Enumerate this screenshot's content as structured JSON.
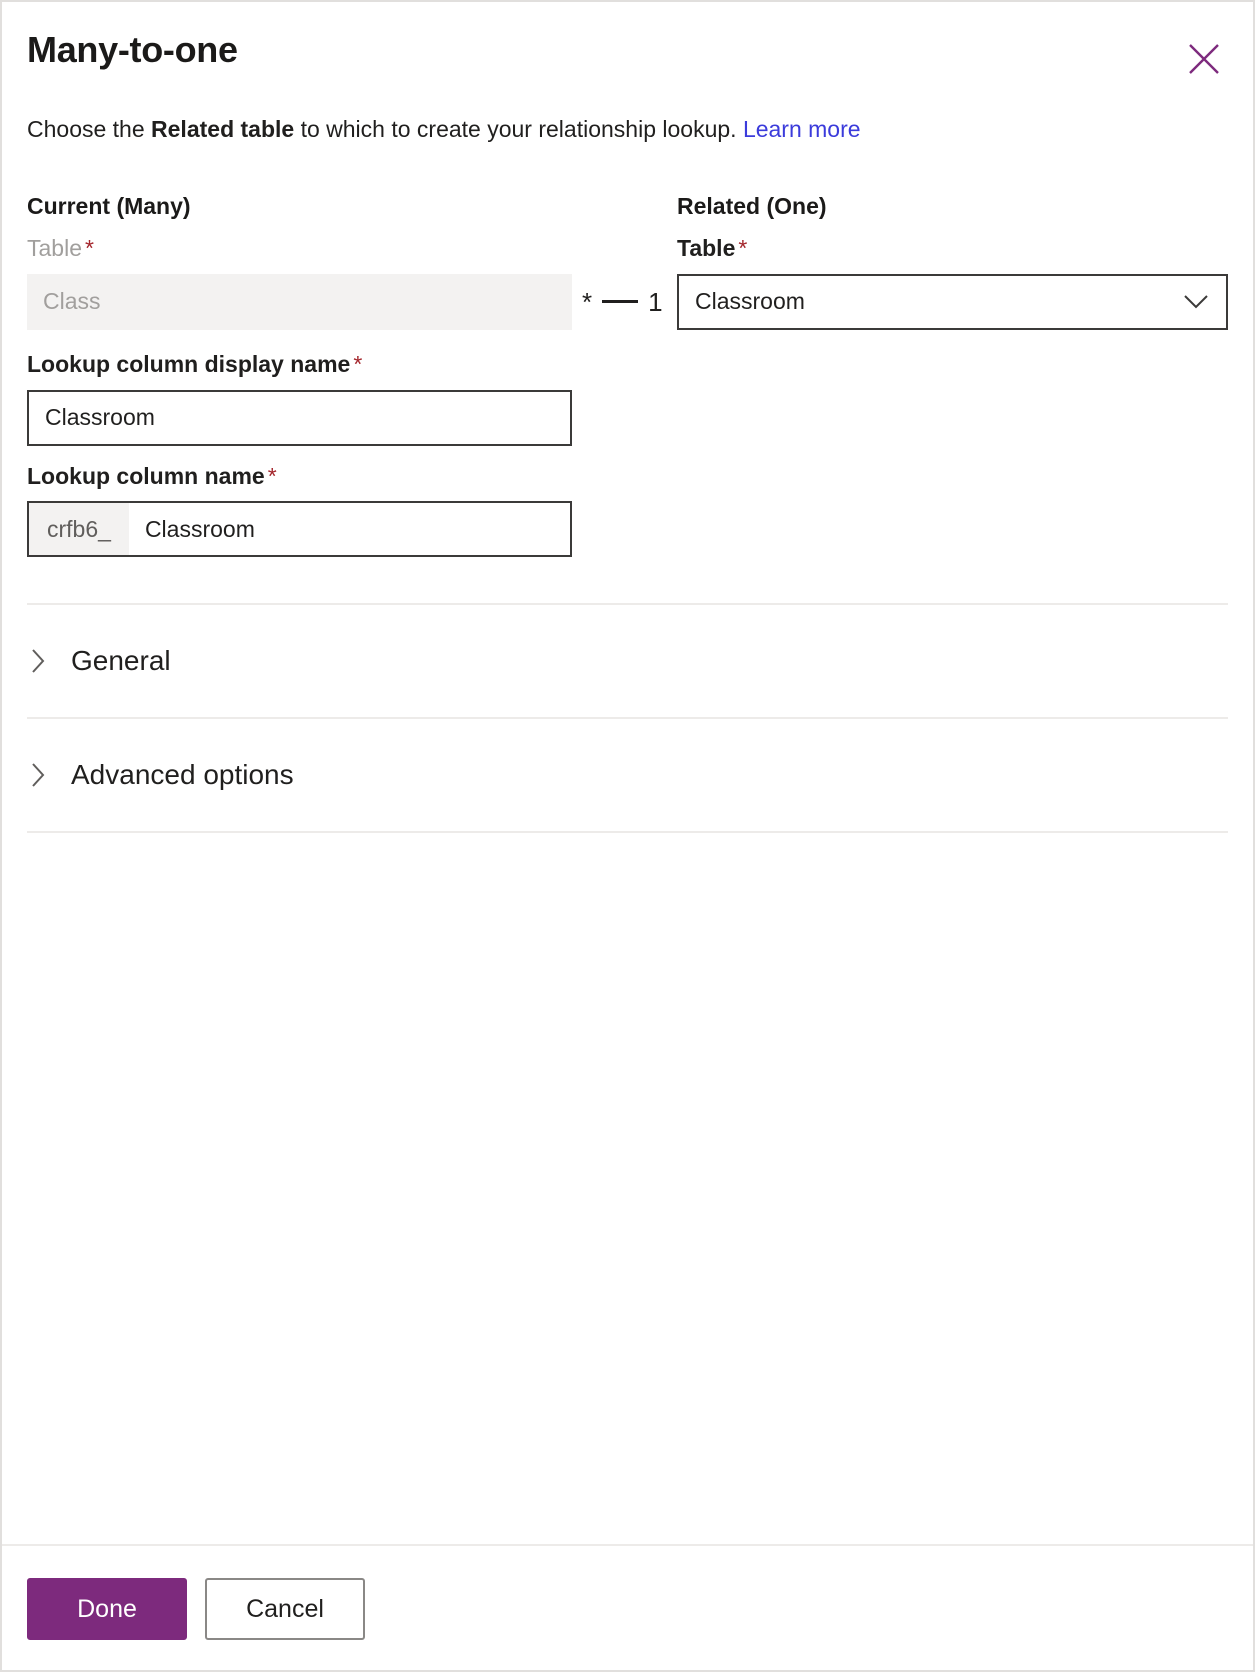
{
  "dialog": {
    "title": "Many-to-one",
    "close_icon": "close-icon"
  },
  "subtitle": {
    "before": "Choose the ",
    "emphasis": "Related table",
    "after": " to which to create your relationship lookup. ",
    "link": "Learn more"
  },
  "current": {
    "heading": "Current (Many)",
    "table_label": "Table",
    "required_mark": "*",
    "table_value": "Class"
  },
  "related": {
    "heading": "Related (One)",
    "table_label": "Table",
    "required_mark": "*",
    "table_value": "Classroom",
    "chevron_icon": "chevron-down-icon"
  },
  "cardinality": {
    "many": "*",
    "one": "1"
  },
  "lookup_display": {
    "label": "Lookup column display name",
    "required_mark": "*",
    "value": "Classroom"
  },
  "lookup_name": {
    "label": "Lookup column name",
    "required_mark": "*",
    "prefix": "crfb6_",
    "value": "Classroom"
  },
  "sections": [
    {
      "label": "General",
      "icon": "chevron-right-icon",
      "expanded": false
    },
    {
      "label": "Advanced options",
      "icon": "chevron-right-icon",
      "expanded": false
    }
  ],
  "footer": {
    "done_label": "Done",
    "cancel_label": "Cancel"
  },
  "colors": {
    "accent": "#7d2a7d",
    "link": "#3b3bdb",
    "required": "#a4262c",
    "disabled_bg": "#f3f2f1",
    "border": "#3b3a39",
    "divider": "#edebe9"
  }
}
